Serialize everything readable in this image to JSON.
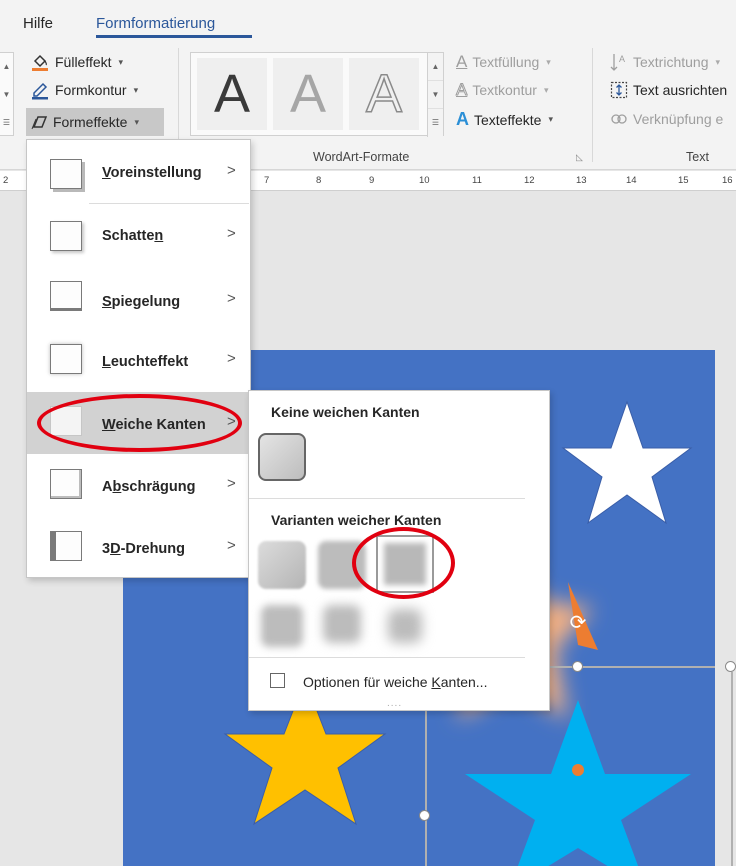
{
  "tabs": [
    {
      "label": "Hilfe",
      "active": false
    },
    {
      "label": "Formformatierung",
      "active": true
    }
  ],
  "ribbon": {
    "shape_styles": {
      "fill": {
        "label": "Fülleffekt",
        "icon": "paint-bucket-icon"
      },
      "outline": {
        "label": "Formkontur",
        "icon": "pen-outline-icon"
      },
      "effects": {
        "label": "Formeffekte",
        "icon": "shape-effects-icon",
        "pressed": true
      }
    },
    "wordart": {
      "gallery_letter": "A",
      "group_label": "WordArt-Formate",
      "text_fill": {
        "label": "Textfüllung",
        "icon": "text-fill-icon"
      },
      "text_outline": {
        "label": "Textkontur",
        "icon": "text-outline-icon"
      },
      "text_effects": {
        "label": "Texteffekte",
        "icon": "text-effects-icon"
      }
    },
    "text": {
      "group_label": "Text",
      "direction": {
        "label": "Textrichtung",
        "icon": "text-direction-icon"
      },
      "align": {
        "label": "Text ausrichten",
        "icon": "align-text-icon"
      },
      "link": {
        "label": "Verknüpfung e",
        "icon": "link-icon"
      }
    }
  },
  "ruler": {
    "numbers": [
      "2",
      "7",
      "8",
      "9",
      "10",
      "11",
      "12",
      "13",
      "14",
      "15",
      "16"
    ]
  },
  "menu": {
    "items": [
      {
        "label": "Voreinstellung",
        "underline": "V",
        "rest": "oreinstellung",
        "icon": "preset-icon"
      },
      {
        "label": "Schatten",
        "underline": "n",
        "pre": "Schatte",
        "icon": "shadow-icon"
      },
      {
        "label": "Spiegelung",
        "underline": "S",
        "rest": "piegelung",
        "icon": "reflection-icon"
      },
      {
        "label": "Leuchteffekt",
        "underline": "L",
        "rest": "euchteffekt",
        "icon": "glow-icon"
      },
      {
        "label": "Weiche Kanten",
        "underline": "W",
        "rest": "eiche Kanten",
        "icon": "soft-edges-icon",
        "selected": true
      },
      {
        "label": "Abschrägung",
        "pre": "A",
        "underline": "b",
        "rest": "schrägung",
        "icon": "bevel-icon"
      },
      {
        "label": "3D-Drehung",
        "pre": "3",
        "underline": "D",
        "rest": "-Drehung",
        "icon": "3d-rotation-icon"
      }
    ]
  },
  "submenu": {
    "heading_none": "Keine weichen Kanten",
    "heading_variants": "Varianten weicher Kanten",
    "variant_count": 6,
    "highlighted_variant": 3,
    "options_pre": "Optionen für weiche ",
    "options_underline": "K",
    "options_rest": "anten...",
    "grip": "....",
    "checkbox_checked": false
  },
  "colors": {
    "ribbon_bg": "#f3f3f3",
    "accent": "#2b579a",
    "slide_bg": "#4472c4",
    "star_white": "#ffffff",
    "star_yellow": "#ffc000",
    "star_light_blue": "#00b0f0",
    "star_orange": "#ed7d31",
    "highlight_red": "#e10010"
  }
}
